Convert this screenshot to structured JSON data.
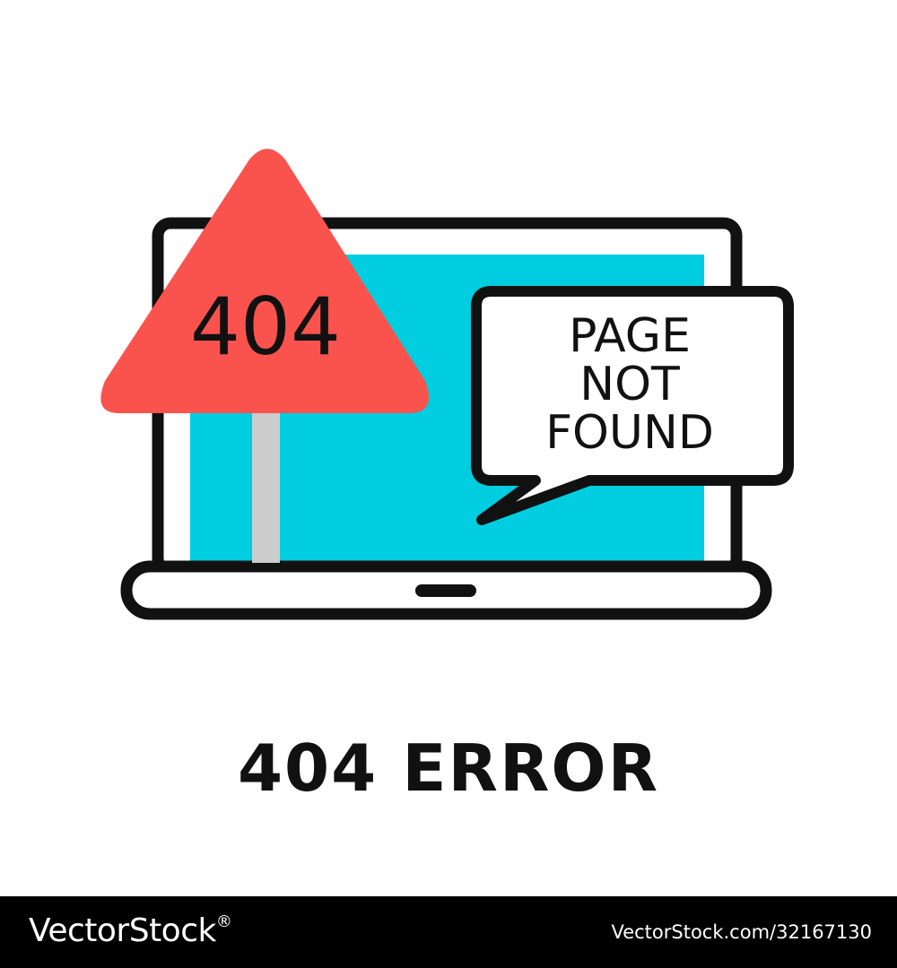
{
  "illustration": {
    "sign_text": "404",
    "bubble_lines": [
      "PAGE",
      "NOT",
      "FOUND"
    ],
    "colors": {
      "screen": "#00cde0",
      "sign": "#fa534e",
      "post": "#cccccc",
      "outline": "#111111"
    }
  },
  "caption": "404 ERROR",
  "footer": {
    "brand": "VectorStock",
    "brand_mark": "®",
    "image_id": "VectorStock.com/32167130"
  }
}
